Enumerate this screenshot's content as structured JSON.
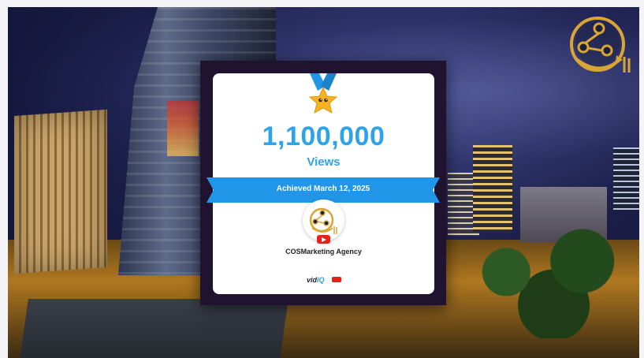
{
  "achievement": {
    "count": "1,100,000",
    "unit": "Views",
    "date_label": "Achieved March 12, 2025"
  },
  "channel": {
    "name": "COSMarketing Agency",
    "avatar_icon": "cosmarketing-logo-icon",
    "platform_icon": "youtube-icon"
  },
  "branding": {
    "vid": "vid",
    "iq": "IQ",
    "tube_icon": "youtube-mini-icon",
    "corner_logo_icon": "share-network-logo-icon"
  },
  "colors": {
    "accent_blue": "#2ea3e8",
    "ribbon_blue": "#2196e8",
    "frame": "#1f1330",
    "gold": "#d9a534",
    "youtube_red": "#e62117"
  }
}
